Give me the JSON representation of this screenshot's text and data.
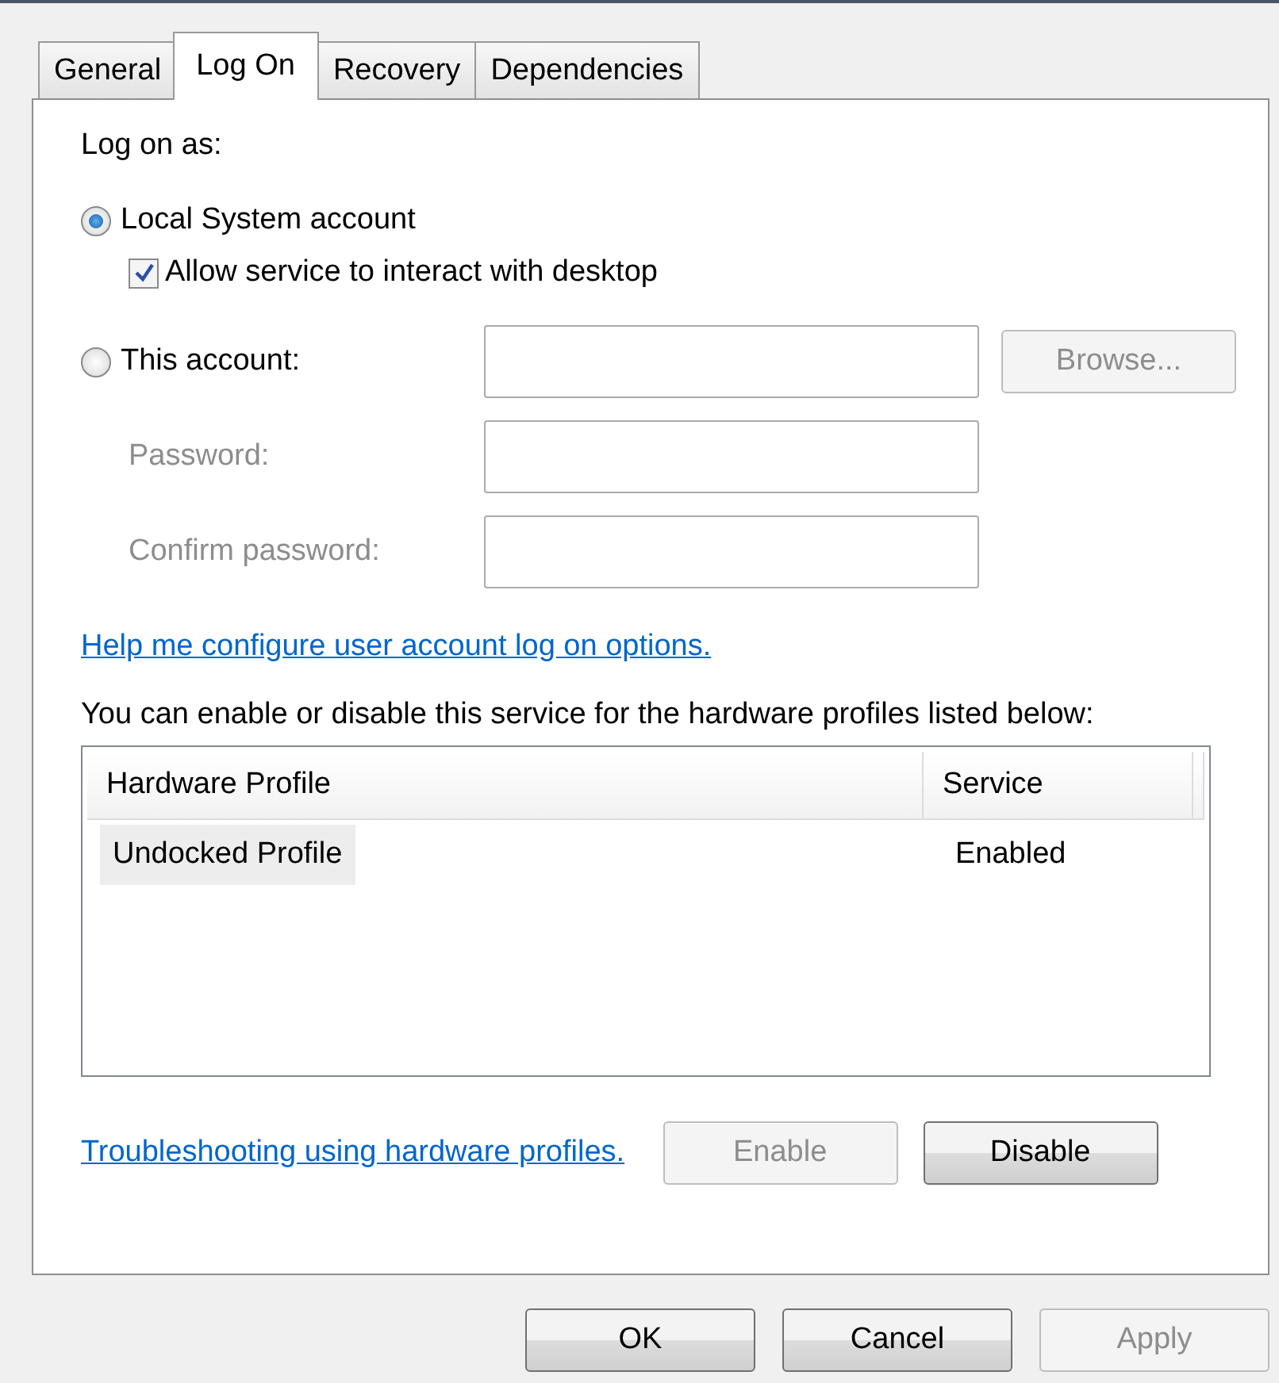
{
  "tabs": [
    {
      "label": "General",
      "selected": false
    },
    {
      "label": "Log On",
      "selected": true
    },
    {
      "label": "Recovery",
      "selected": false
    },
    {
      "label": "Dependencies",
      "selected": false
    }
  ],
  "log_on_as": "Log on as:",
  "local_system": {
    "label": "Local System account",
    "selected": true
  },
  "interact": {
    "label": "Allow service to interact with desktop",
    "checked": true
  },
  "this_account": {
    "label": "This account:",
    "selected": false
  },
  "browse": {
    "label": "Browse...",
    "disabled": true
  },
  "credential_fields": [
    {
      "label": "Password:",
      "disabled": true
    },
    {
      "label": "Confirm password:",
      "disabled": true
    }
  ],
  "help_link": "Help me configure user account log on options.",
  "profiles_text": "You can enable or disable this service for the hardware profiles listed below:",
  "table": {
    "columns": [
      "Hardware Profile",
      "Service"
    ],
    "rows": [
      {
        "cells": [
          "Undocked Profile",
          "Enabled"
        ],
        "selected": true
      }
    ]
  },
  "troubleshoot_link": "Troubleshooting using hardware profiles.",
  "profile_buttons": [
    {
      "label": "Enable",
      "disabled": true
    },
    {
      "label": "Disable",
      "disabled": false
    }
  ],
  "dialog_buttons": [
    {
      "label": "OK",
      "disabled": false
    },
    {
      "label": "Cancel",
      "disabled": false
    },
    {
      "label": "Apply",
      "disabled": true
    }
  ]
}
